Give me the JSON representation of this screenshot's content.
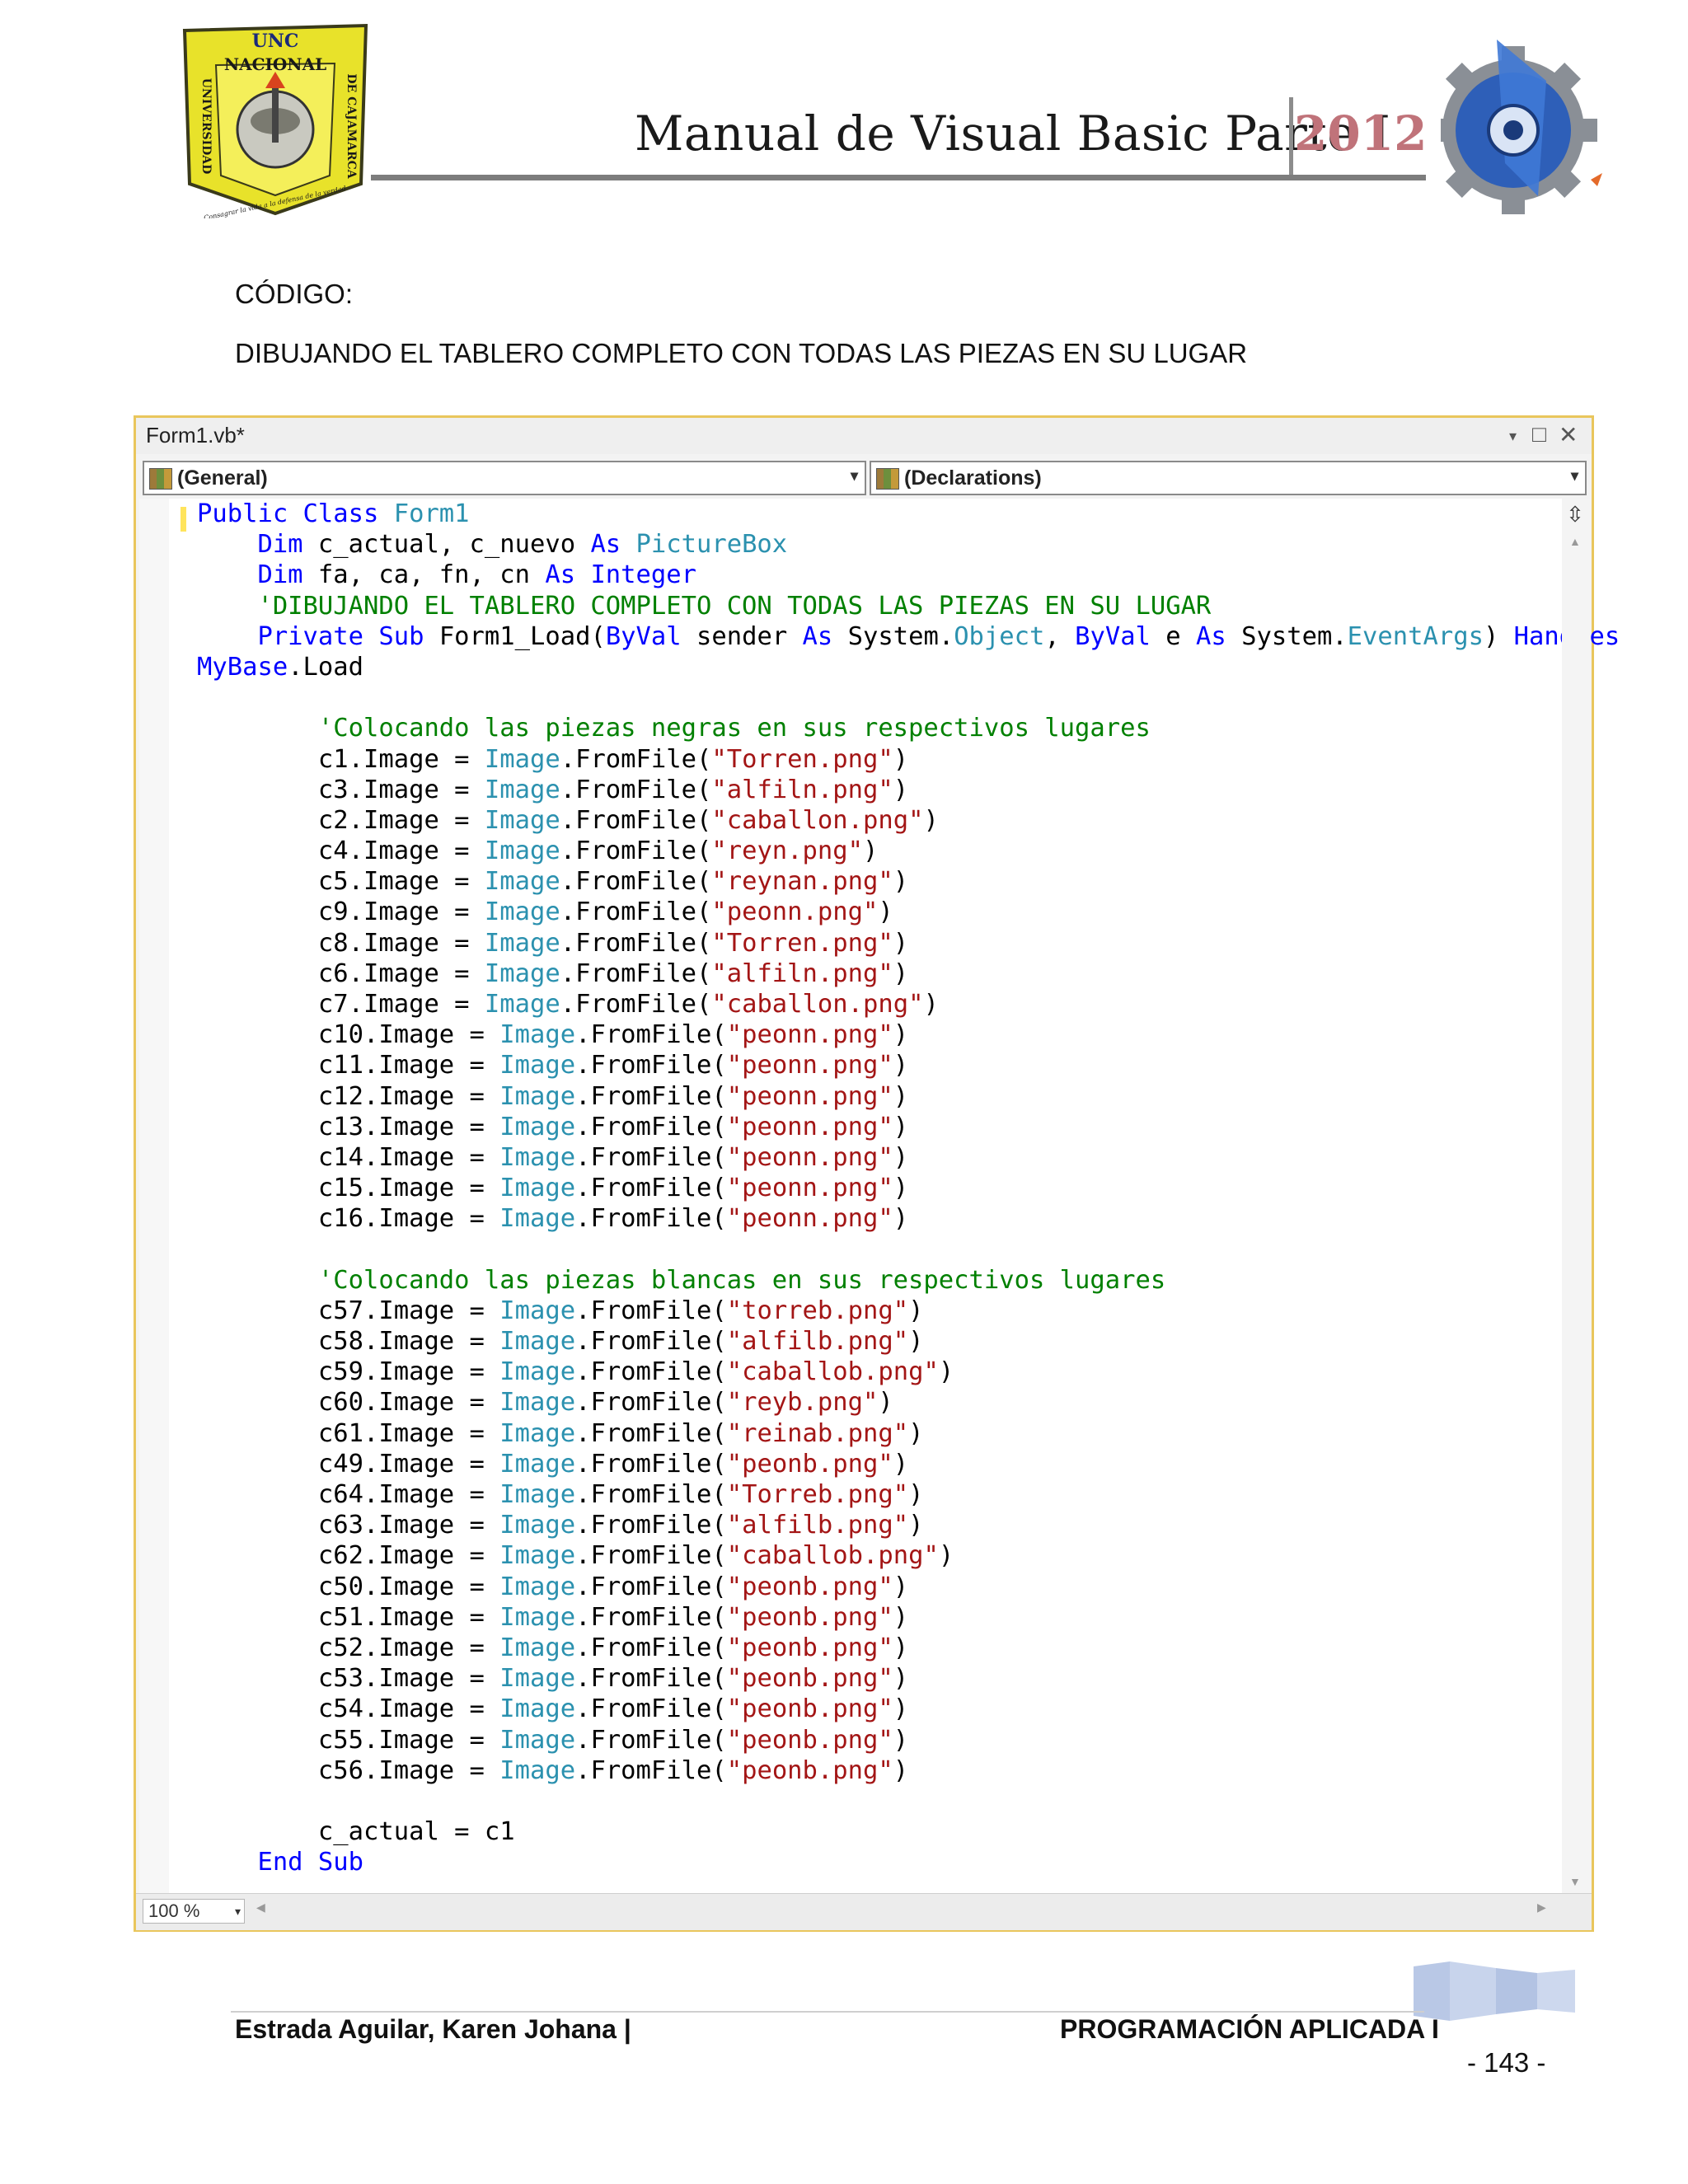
{
  "header": {
    "title": "Manual de Visual Basic Parte I",
    "year": "2012",
    "logo_left": {
      "top_text": "UNC",
      "middle_text": "NACIONAL",
      "left_text": "UNIVERSIDAD",
      "right_text": "DE CAJAMARCA",
      "bottom_text": "Consagrar la vida a la defensa de la verdad"
    }
  },
  "labels": {
    "codigo": "CÓDIGO:",
    "heading": "DIBUJANDO EL TABLERO COMPLETO CON TODAS LAS PIEZAS EN SU LUGAR"
  },
  "ide": {
    "tab_title": "Form1.vb*",
    "controls": {
      "dropdown": "▾",
      "maximize": "□",
      "close": "✕"
    },
    "combo_left": "(General)",
    "combo_right": "(Declarations)",
    "zoom": "100 %"
  },
  "code_lines": [
    [
      {
        "t": "Public Class ",
        "c": "kw"
      },
      {
        "t": "Form1",
        "c": "ty"
      }
    ],
    [
      {
        "t": "    Dim ",
        "c": "kw"
      },
      {
        "t": "c_actual, c_nuevo ",
        "c": ""
      },
      {
        "t": "As ",
        "c": "kw"
      },
      {
        "t": "PictureBox",
        "c": "ty"
      }
    ],
    [
      {
        "t": "    Dim ",
        "c": "kw"
      },
      {
        "t": "fa, ca, fn, cn ",
        "c": ""
      },
      {
        "t": "As Integer",
        "c": "kw"
      }
    ],
    [
      {
        "t": "    'DIBUJANDO EL TABLERO COMPLETO CON TODAS LAS PIEZAS EN SU LUGAR",
        "c": "cm"
      }
    ],
    [
      {
        "t": "    Private Sub ",
        "c": "kw"
      },
      {
        "t": "Form1_Load(",
        "c": ""
      },
      {
        "t": "ByVal ",
        "c": "kw"
      },
      {
        "t": "sender ",
        "c": ""
      },
      {
        "t": "As ",
        "c": "kw"
      },
      {
        "t": "System.",
        "c": ""
      },
      {
        "t": "Object",
        "c": "ty"
      },
      {
        "t": ", ",
        "c": ""
      },
      {
        "t": "ByVal ",
        "c": "kw"
      },
      {
        "t": "e ",
        "c": ""
      },
      {
        "t": "As ",
        "c": "kw"
      },
      {
        "t": "System.",
        "c": ""
      },
      {
        "t": "EventArgs",
        "c": "ty"
      },
      {
        "t": ") ",
        "c": ""
      },
      {
        "t": "Handles",
        "c": "kw"
      }
    ],
    [
      {
        "t": "MyBase",
        "c": "kw"
      },
      {
        "t": ".Load",
        "c": ""
      }
    ],
    [],
    [
      {
        "t": "        'Colocando las piezas negras en sus respectivos lugares",
        "c": "cm"
      }
    ],
    [
      {
        "t": "        c1.Image = ",
        "c": ""
      },
      {
        "t": "Image",
        "c": "ty"
      },
      {
        "t": ".FromFile(",
        "c": ""
      },
      {
        "t": "\"Torren.png\"",
        "c": "st"
      },
      {
        "t": ")",
        "c": ""
      }
    ],
    [
      {
        "t": "        c3.Image = ",
        "c": ""
      },
      {
        "t": "Image",
        "c": "ty"
      },
      {
        "t": ".FromFile(",
        "c": ""
      },
      {
        "t": "\"alfiln.png\"",
        "c": "st"
      },
      {
        "t": ")",
        "c": ""
      }
    ],
    [
      {
        "t": "        c2.Image = ",
        "c": ""
      },
      {
        "t": "Image",
        "c": "ty"
      },
      {
        "t": ".FromFile(",
        "c": ""
      },
      {
        "t": "\"caballon.png\"",
        "c": "st"
      },
      {
        "t": ")",
        "c": ""
      }
    ],
    [
      {
        "t": "        c4.Image = ",
        "c": ""
      },
      {
        "t": "Image",
        "c": "ty"
      },
      {
        "t": ".FromFile(",
        "c": ""
      },
      {
        "t": "\"reyn.png\"",
        "c": "st"
      },
      {
        "t": ")",
        "c": ""
      }
    ],
    [
      {
        "t": "        c5.Image = ",
        "c": ""
      },
      {
        "t": "Image",
        "c": "ty"
      },
      {
        "t": ".FromFile(",
        "c": ""
      },
      {
        "t": "\"reynan.png\"",
        "c": "st"
      },
      {
        "t": ")",
        "c": ""
      }
    ],
    [
      {
        "t": "        c9.Image = ",
        "c": ""
      },
      {
        "t": "Image",
        "c": "ty"
      },
      {
        "t": ".FromFile(",
        "c": ""
      },
      {
        "t": "\"peonn.png\"",
        "c": "st"
      },
      {
        "t": ")",
        "c": ""
      }
    ],
    [
      {
        "t": "        c8.Image = ",
        "c": ""
      },
      {
        "t": "Image",
        "c": "ty"
      },
      {
        "t": ".FromFile(",
        "c": ""
      },
      {
        "t": "\"Torren.png\"",
        "c": "st"
      },
      {
        "t": ")",
        "c": ""
      }
    ],
    [
      {
        "t": "        c6.Image = ",
        "c": ""
      },
      {
        "t": "Image",
        "c": "ty"
      },
      {
        "t": ".FromFile(",
        "c": ""
      },
      {
        "t": "\"alfiln.png\"",
        "c": "st"
      },
      {
        "t": ")",
        "c": ""
      }
    ],
    [
      {
        "t": "        c7.Image = ",
        "c": ""
      },
      {
        "t": "Image",
        "c": "ty"
      },
      {
        "t": ".FromFile(",
        "c": ""
      },
      {
        "t": "\"caballon.png\"",
        "c": "st"
      },
      {
        "t": ")",
        "c": ""
      }
    ],
    [
      {
        "t": "        c10.Image = ",
        "c": ""
      },
      {
        "t": "Image",
        "c": "ty"
      },
      {
        "t": ".FromFile(",
        "c": ""
      },
      {
        "t": "\"peonn.png\"",
        "c": "st"
      },
      {
        "t": ")",
        "c": ""
      }
    ],
    [
      {
        "t": "        c11.Image = ",
        "c": ""
      },
      {
        "t": "Image",
        "c": "ty"
      },
      {
        "t": ".FromFile(",
        "c": ""
      },
      {
        "t": "\"peonn.png\"",
        "c": "st"
      },
      {
        "t": ")",
        "c": ""
      }
    ],
    [
      {
        "t": "        c12.Image = ",
        "c": ""
      },
      {
        "t": "Image",
        "c": "ty"
      },
      {
        "t": ".FromFile(",
        "c": ""
      },
      {
        "t": "\"peonn.png\"",
        "c": "st"
      },
      {
        "t": ")",
        "c": ""
      }
    ],
    [
      {
        "t": "        c13.Image = ",
        "c": ""
      },
      {
        "t": "Image",
        "c": "ty"
      },
      {
        "t": ".FromFile(",
        "c": ""
      },
      {
        "t": "\"peonn.png\"",
        "c": "st"
      },
      {
        "t": ")",
        "c": ""
      }
    ],
    [
      {
        "t": "        c14.Image = ",
        "c": ""
      },
      {
        "t": "Image",
        "c": "ty"
      },
      {
        "t": ".FromFile(",
        "c": ""
      },
      {
        "t": "\"peonn.png\"",
        "c": "st"
      },
      {
        "t": ")",
        "c": ""
      }
    ],
    [
      {
        "t": "        c15.Image = ",
        "c": ""
      },
      {
        "t": "Image",
        "c": "ty"
      },
      {
        "t": ".FromFile(",
        "c": ""
      },
      {
        "t": "\"peonn.png\"",
        "c": "st"
      },
      {
        "t": ")",
        "c": ""
      }
    ],
    [
      {
        "t": "        c16.Image = ",
        "c": ""
      },
      {
        "t": "Image",
        "c": "ty"
      },
      {
        "t": ".FromFile(",
        "c": ""
      },
      {
        "t": "\"peonn.png\"",
        "c": "st"
      },
      {
        "t": ")",
        "c": ""
      }
    ],
    [],
    [
      {
        "t": "        'Colocando las piezas blancas en sus respectivos lugares",
        "c": "cm"
      }
    ],
    [
      {
        "t": "        c57.Image = ",
        "c": ""
      },
      {
        "t": "Image",
        "c": "ty"
      },
      {
        "t": ".FromFile(",
        "c": ""
      },
      {
        "t": "\"torreb.png\"",
        "c": "st"
      },
      {
        "t": ")",
        "c": ""
      }
    ],
    [
      {
        "t": "        c58.Image = ",
        "c": ""
      },
      {
        "t": "Image",
        "c": "ty"
      },
      {
        "t": ".FromFile(",
        "c": ""
      },
      {
        "t": "\"alfilb.png\"",
        "c": "st"
      },
      {
        "t": ")",
        "c": ""
      }
    ],
    [
      {
        "t": "        c59.Image = ",
        "c": ""
      },
      {
        "t": "Image",
        "c": "ty"
      },
      {
        "t": ".FromFile(",
        "c": ""
      },
      {
        "t": "\"caballob.png\"",
        "c": "st"
      },
      {
        "t": ")",
        "c": ""
      }
    ],
    [
      {
        "t": "        c60.Image = ",
        "c": ""
      },
      {
        "t": "Image",
        "c": "ty"
      },
      {
        "t": ".FromFile(",
        "c": ""
      },
      {
        "t": "\"reyb.png\"",
        "c": "st"
      },
      {
        "t": ")",
        "c": ""
      }
    ],
    [
      {
        "t": "        c61.Image = ",
        "c": ""
      },
      {
        "t": "Image",
        "c": "ty"
      },
      {
        "t": ".FromFile(",
        "c": ""
      },
      {
        "t": "\"reinab.png\"",
        "c": "st"
      },
      {
        "t": ")",
        "c": ""
      }
    ],
    [
      {
        "t": "        c49.Image = ",
        "c": ""
      },
      {
        "t": "Image",
        "c": "ty"
      },
      {
        "t": ".FromFile(",
        "c": ""
      },
      {
        "t": "\"peonb.png\"",
        "c": "st"
      },
      {
        "t": ")",
        "c": ""
      }
    ],
    [
      {
        "t": "        c64.Image = ",
        "c": ""
      },
      {
        "t": "Image",
        "c": "ty"
      },
      {
        "t": ".FromFile(",
        "c": ""
      },
      {
        "t": "\"Torreb.png\"",
        "c": "st"
      },
      {
        "t": ")",
        "c": ""
      }
    ],
    [
      {
        "t": "        c63.Image = ",
        "c": ""
      },
      {
        "t": "Image",
        "c": "ty"
      },
      {
        "t": ".FromFile(",
        "c": ""
      },
      {
        "t": "\"alfilb.png\"",
        "c": "st"
      },
      {
        "t": ")",
        "c": ""
      }
    ],
    [
      {
        "t": "        c62.Image = ",
        "c": ""
      },
      {
        "t": "Image",
        "c": "ty"
      },
      {
        "t": ".FromFile(",
        "c": ""
      },
      {
        "t": "\"caballob.png\"",
        "c": "st"
      },
      {
        "t": ")",
        "c": ""
      }
    ],
    [
      {
        "t": "        c50.Image = ",
        "c": ""
      },
      {
        "t": "Image",
        "c": "ty"
      },
      {
        "t": ".FromFile(",
        "c": ""
      },
      {
        "t": "\"peonb.png\"",
        "c": "st"
      },
      {
        "t": ")",
        "c": ""
      }
    ],
    [
      {
        "t": "        c51.Image = ",
        "c": ""
      },
      {
        "t": "Image",
        "c": "ty"
      },
      {
        "t": ".FromFile(",
        "c": ""
      },
      {
        "t": "\"peonb.png\"",
        "c": "st"
      },
      {
        "t": ")",
        "c": ""
      }
    ],
    [
      {
        "t": "        c52.Image = ",
        "c": ""
      },
      {
        "t": "Image",
        "c": "ty"
      },
      {
        "t": ".FromFile(",
        "c": ""
      },
      {
        "t": "\"peonb.png\"",
        "c": "st"
      },
      {
        "t": ")",
        "c": ""
      }
    ],
    [
      {
        "t": "        c53.Image = ",
        "c": ""
      },
      {
        "t": "Image",
        "c": "ty"
      },
      {
        "t": ".FromFile(",
        "c": ""
      },
      {
        "t": "\"peonb.png\"",
        "c": "st"
      },
      {
        "t": ")",
        "c": ""
      }
    ],
    [
      {
        "t": "        c54.Image = ",
        "c": ""
      },
      {
        "t": "Image",
        "c": "ty"
      },
      {
        "t": ".FromFile(",
        "c": ""
      },
      {
        "t": "\"peonb.png\"",
        "c": "st"
      },
      {
        "t": ")",
        "c": ""
      }
    ],
    [
      {
        "t": "        c55.Image = ",
        "c": ""
      },
      {
        "t": "Image",
        "c": "ty"
      },
      {
        "t": ".FromFile(",
        "c": ""
      },
      {
        "t": "\"peonb.png\"",
        "c": "st"
      },
      {
        "t": ")",
        "c": ""
      }
    ],
    [
      {
        "t": "        c56.Image = ",
        "c": ""
      },
      {
        "t": "Image",
        "c": "ty"
      },
      {
        "t": ".FromFile(",
        "c": ""
      },
      {
        "t": "\"peonb.png\"",
        "c": "st"
      },
      {
        "t": ")",
        "c": ""
      }
    ],
    [],
    [
      {
        "t": "        c_actual = c1",
        "c": ""
      }
    ],
    [
      {
        "t": "    End Sub",
        "c": "kw"
      }
    ]
  ],
  "footer": {
    "author": "Estrada Aguilar, Karen Johana |",
    "course": "PROGRAMACIÓN APLICADA I",
    "page": "- 143 -"
  },
  "colors": {
    "keyword": "#0000ff",
    "type": "#2b91af",
    "string": "#a31515",
    "comment": "#008000",
    "window_border": "#e9c65c",
    "year": "#c0737a"
  }
}
